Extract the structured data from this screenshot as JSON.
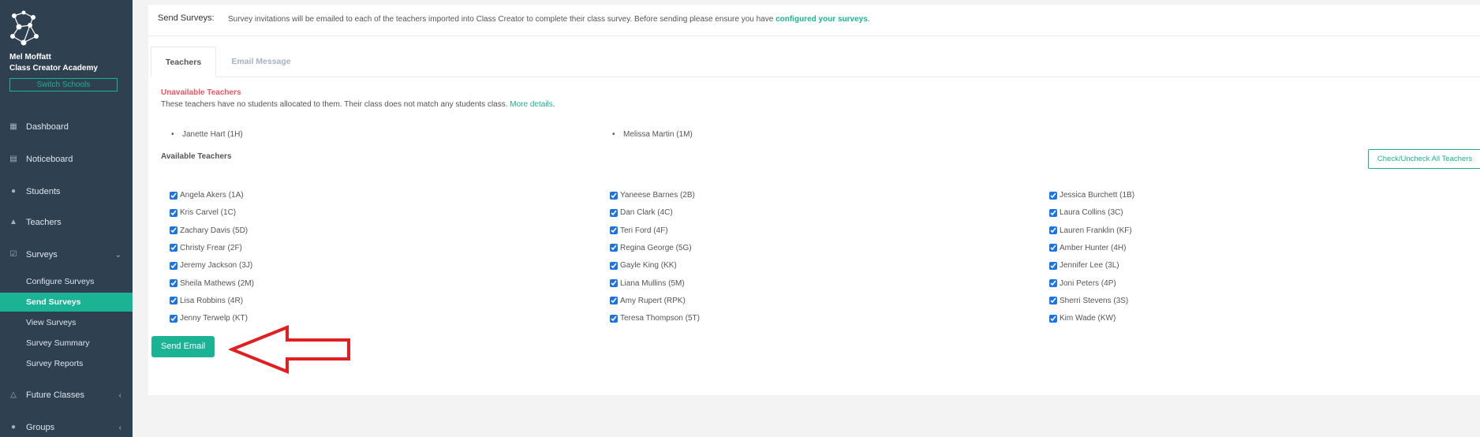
{
  "user": {
    "name": "Mel Moffatt",
    "school": "Class Creator Academy",
    "switch_label": "Switch Schools"
  },
  "nav": {
    "items": [
      {
        "label": "Dashboard",
        "icon": "dashboard-icon"
      },
      {
        "label": "Noticeboard",
        "icon": "noticeboard-icon"
      },
      {
        "label": "Students",
        "icon": "user-icon"
      },
      {
        "label": "Teachers",
        "icon": "graduation-cap-icon"
      },
      {
        "label": "Surveys",
        "icon": "check-square-icon"
      }
    ],
    "survey_sub": [
      "Configure Surveys",
      "Send Surveys",
      "View Surveys",
      "Survey Summary",
      "Survey Reports"
    ],
    "lower_items": [
      {
        "label": "Future Classes",
        "icon": "flask-icon"
      },
      {
        "label": "Groups",
        "icon": "groups-icon"
      }
    ]
  },
  "header": {
    "title": "Send Surveys:",
    "desc_prefix": "Survey invitations will be emailed to each of the teachers imported into Class Creator to complete their class survey. Before sending please ensure you have",
    "desc_link": "configured your surveys",
    "desc_suffix": "."
  },
  "tabs": [
    "Teachers",
    "Email Message"
  ],
  "unavailable": {
    "title": "Unavailable Teachers",
    "desc": "These teachers have no students allocated to them. Their class does not match any students class.",
    "link": "More details",
    "link_suffix": ".",
    "teachers": [
      "Janette Hart (1H)",
      "Melissa Martin (1M)"
    ]
  },
  "available": {
    "title": "Available Teachers",
    "check_all_label": "Check/Uncheck All Teachers",
    "col1": [
      "Angela Akers (1A)",
      "Kris Carvel (1C)",
      "Zachary Davis (5D)",
      "Christy Frear (2F)",
      "Jeremy Jackson (3J)",
      "Sheila Mathews (2M)",
      "Lisa Robbins (4R)",
      "Jenny Terwelp (KT)"
    ],
    "col2": [
      "Yaneese Barnes (2B)",
      "Dan Clark (4C)",
      "Teri Ford (4F)",
      "Regina George (5G)",
      "Gayle King (KK)",
      "Liana Mullins (5M)",
      "Amy Rupert (RPK)",
      "Teresa Thompson (5T)"
    ],
    "col3": [
      "Jessica Burchett (1B)",
      "Laura Collins (3C)",
      "Lauren Franklin (KF)",
      "Amber Hunter (4H)",
      "Jennifer Lee (3L)",
      "Joni Peters (4P)",
      "Sherri Stevens (3S)",
      "Kim Wade (KW)"
    ]
  },
  "send_label": "Send Email",
  "colors": {
    "sidebar": "#2f4050",
    "accent": "#1ab394",
    "danger": "#ed5565",
    "arrow": "#e02020"
  }
}
